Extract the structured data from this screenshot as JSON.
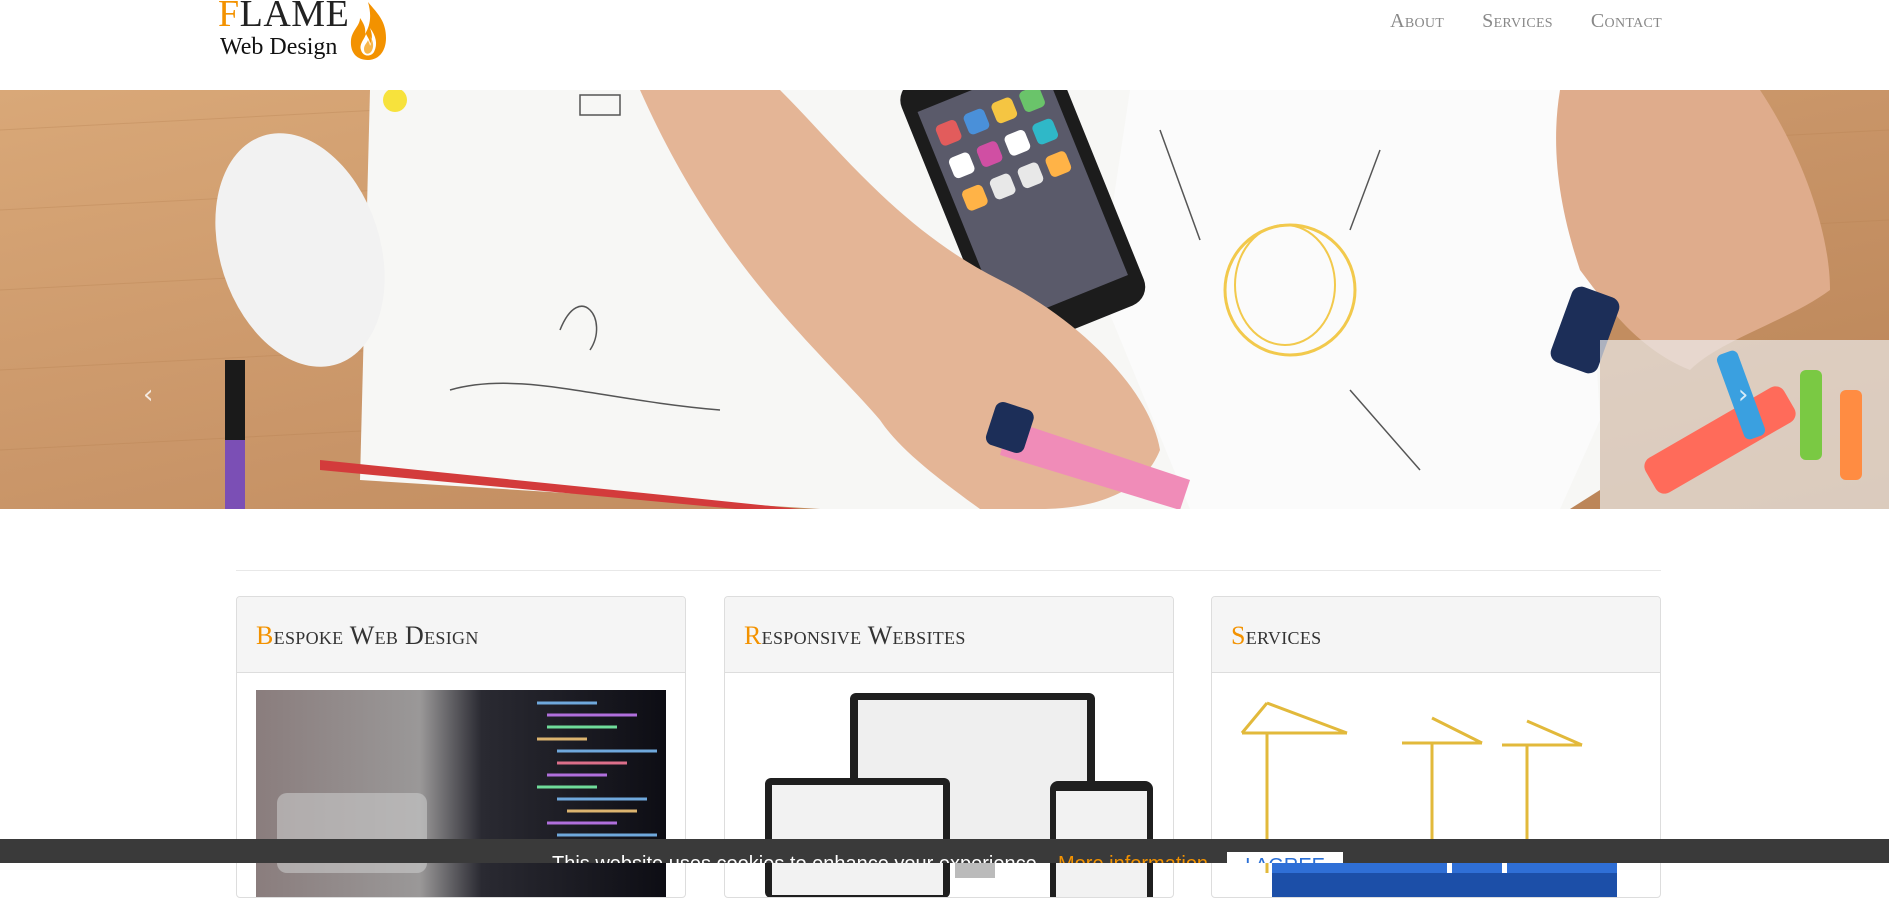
{
  "header": {
    "logo_first_letter": "F",
    "logo_rest": "LAME",
    "logo_tagline": "Web Design"
  },
  "nav": {
    "items": [
      {
        "label": "About"
      },
      {
        "label": "Services"
      },
      {
        "label": "Contact"
      }
    ]
  },
  "hero": {
    "prev_arrow": "‹",
    "next_arrow": "›"
  },
  "cards": [
    {
      "title_initial": "B",
      "title_rest": "espoke Web Design"
    },
    {
      "title_initial": "R",
      "title_rest": "esponsive Websites"
    },
    {
      "title_initial": "S",
      "title_rest": "ervices"
    }
  ],
  "cookie": {
    "text": "This website uses cookies to enhance your experience.",
    "more_info": "More information",
    "agree": "I AGREE"
  },
  "colors": {
    "accent": "#f39200",
    "cookie_bg": "#3a3a3a",
    "nav_text": "#888888"
  }
}
